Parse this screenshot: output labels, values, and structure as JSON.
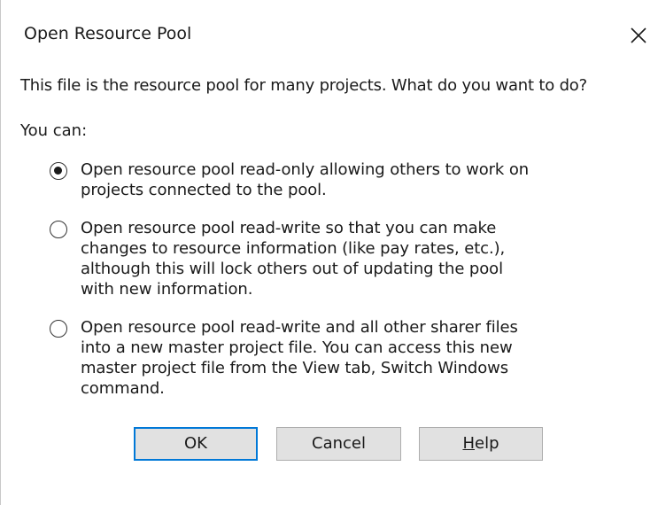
{
  "dialog": {
    "title": "Open Resource Pool",
    "prompt": "This file is the resource pool for many projects. What do you want to do?",
    "you_can": "You can:",
    "options": [
      {
        "checked": true,
        "lines": [
          "Open resource pool read-only allowing others to work on",
          "projects connected to the pool."
        ]
      },
      {
        "checked": false,
        "lines": [
          "Open resource pool read-write so that you can make",
          "changes to resource information (like pay rates, etc.),",
          "although this will lock others out of updating the pool",
          "with new information."
        ]
      },
      {
        "checked": false,
        "lines": [
          "Open resource pool read-write and all other sharer files",
          "into a new master project file.  You can access this new",
          "master project file from the View tab, Switch Windows",
          "command."
        ]
      }
    ],
    "buttons": {
      "ok": "OK",
      "cancel": "Cancel",
      "help_mnemonic": "H",
      "help_rest": "elp"
    },
    "close_icon": "close-icon",
    "accent_color": "#0078d7"
  }
}
